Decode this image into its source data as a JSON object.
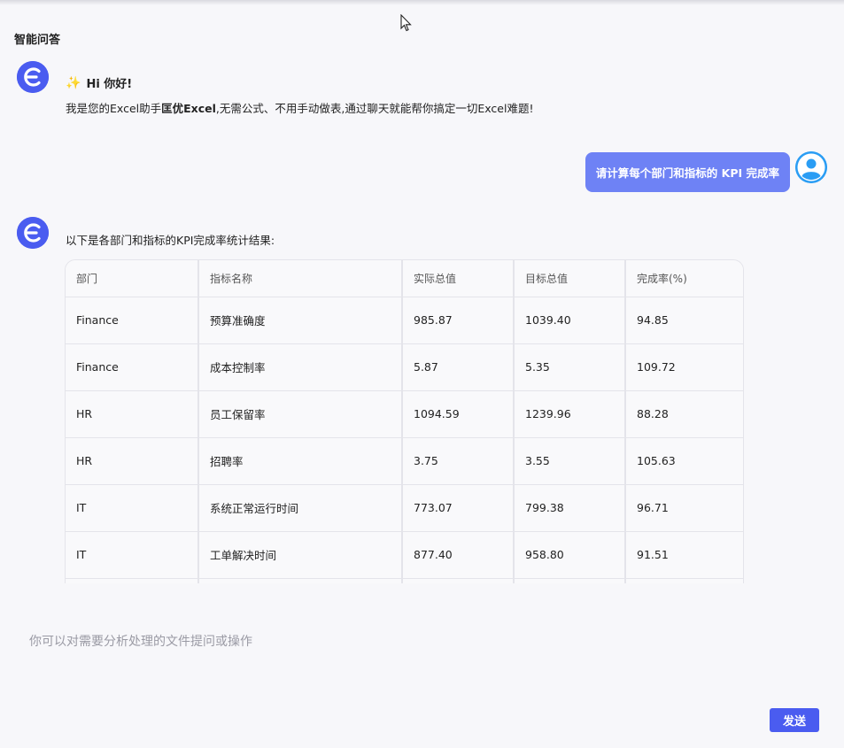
{
  "page": {
    "title": "智能问答"
  },
  "greeting": {
    "icon": "sparkle-icon",
    "hi": "Hi 你好!",
    "intro_prefix": "我是您的Excel助手",
    "brand": "匡优Excel",
    "intro_suffix": ",无需公式、不用手动做表,通过聊天就能帮你搞定一切Excel难题!"
  },
  "user_message": {
    "text": "请计算每个部门和指标的 KPI 完成率"
  },
  "answer": {
    "intro": "以下是各部门和指标的KPI完成率统计结果:",
    "table": {
      "headers": [
        "部门",
        "指标名称",
        "实际总值",
        "目标总值",
        "完成率(%)"
      ],
      "rows": [
        [
          "Finance",
          "预算准确度",
          "985.87",
          "1039.40",
          "94.85"
        ],
        [
          "Finance",
          "成本控制率",
          "5.87",
          "5.35",
          "109.72"
        ],
        [
          "HR",
          "员工保留率",
          "1094.59",
          "1239.96",
          "88.28"
        ],
        [
          "HR",
          "招聘率",
          "3.75",
          "3.55",
          "105.63"
        ],
        [
          "IT",
          "系统正常运行时间",
          "773.07",
          "799.38",
          "96.71"
        ],
        [
          "IT",
          "工单解决时间",
          "877.40",
          "958.80",
          "91.51"
        ],
        [
          "",
          "",
          "",
          "",
          ""
        ]
      ]
    }
  },
  "composer": {
    "placeholder": "你可以对需要分析处理的文件提问或操作",
    "send_label": "发送"
  },
  "colors": {
    "accent": "#4a5cf0",
    "user_bubble": "#6e82f5",
    "user_avatar": "#2a9df4"
  }
}
